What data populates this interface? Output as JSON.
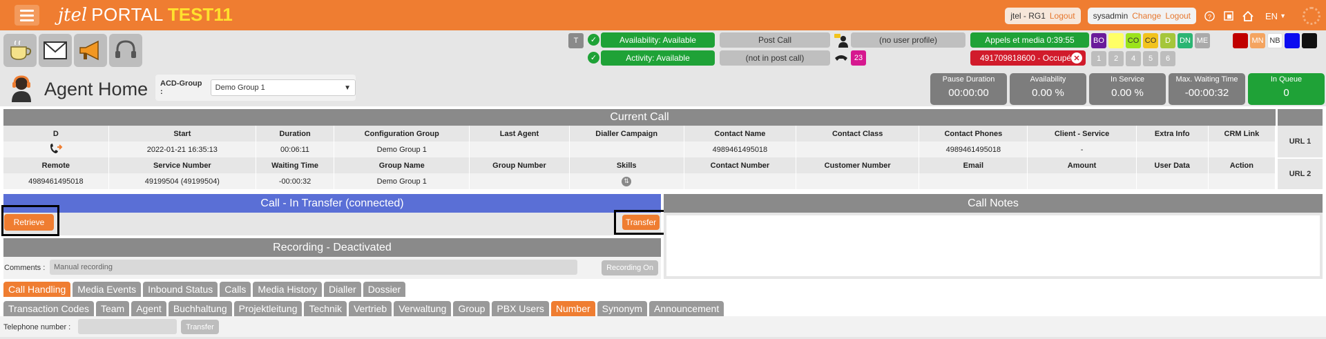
{
  "topbar": {
    "logo_j": "jtel",
    "logo_portal": "PORTAL",
    "logo_env": "TEST11",
    "client_label": "jtel - RG1",
    "client_logout": "Logout",
    "user_label": "sysadmin",
    "user_change": "Change",
    "user_logout": "Logout",
    "language": "EN",
    "icons": [
      "menu-icon",
      "help-icon",
      "window-icon",
      "home-icon",
      "chevron-down-icon",
      "spinner-icon"
    ]
  },
  "status": {
    "t_badge": "T",
    "availability": "Availability: Available",
    "activity": "Activity: Available",
    "post_call_title": "Post Call",
    "post_call_value": "(not in post call)",
    "user_profile": "(no user profile)",
    "queue_count": "23",
    "appels_media": "Appels et media 0:39:55",
    "busy_number": "491709818600 - Occupé",
    "codes_row1": [
      {
        "label": "BO",
        "bg": "#6a1b9a",
        "fg": "#ffffff"
      },
      {
        "label": "",
        "bg": "#ffff66",
        "fg": "#333333"
      },
      {
        "label": "CO",
        "bg": "#9be31b",
        "fg": "#333333"
      },
      {
        "label": "CO",
        "bg": "#f2c31d",
        "fg": "#333333"
      },
      {
        "label": "D",
        "bg": "#a5c63b",
        "fg": "#ffffff"
      },
      {
        "label": "DN",
        "bg": "#2bb573",
        "fg": "#ffffff"
      },
      {
        "label": "ME",
        "bg": "#aaaaaa",
        "fg": "#ffffff"
      }
    ],
    "codes_row1b": [
      {
        "label": "",
        "bg": "#c00000",
        "fg": "#ffffff"
      },
      {
        "label": "MN",
        "bg": "#f4a460",
        "fg": "#ffffff"
      },
      {
        "label": "NB",
        "bg": "#ffffff",
        "fg": "#333333"
      },
      {
        "label": "",
        "bg": "#0c0cf0",
        "fg": "#ffffff"
      },
      {
        "label": "",
        "bg": "#111111",
        "fg": "#ffffff"
      }
    ],
    "numbers_row2": [
      "1",
      "2",
      "4",
      "5",
      "6"
    ]
  },
  "agent": {
    "title": "Agent Home",
    "acd_label": "ACD-Group :",
    "acd_value": "Demo Group 1"
  },
  "kpis": [
    {
      "title": "Pause Duration",
      "value": "00:00:00",
      "bg": "#7d7d7d"
    },
    {
      "title": "Availability",
      "value": "0.00 %",
      "bg": "#7d7d7d"
    },
    {
      "title": "In Service",
      "value": "0.00 %",
      "bg": "#7d7d7d"
    },
    {
      "title": "Max. Waiting Time",
      "value": "-00:00:32",
      "bg": "#7d7d7d"
    },
    {
      "title": "In Queue",
      "value": "0",
      "bg": "#1fa237"
    }
  ],
  "current_call": {
    "title": "Current Call",
    "header1": [
      "D",
      "Start",
      "Duration",
      "Configuration Group",
      "Last Agent",
      "Dialler Campaign",
      "Contact Name",
      "Contact Class",
      "Contact Phones",
      "Client - Service",
      "Extra Info",
      "CRM Link"
    ],
    "values1": [
      "",
      "2022-01-21 16:35:13",
      "00:06:11",
      "Demo Group 1",
      "",
      "",
      "4989461495018",
      "",
      "4989461495018",
      "-",
      "",
      ""
    ],
    "header2": [
      "Remote",
      "Service Number",
      "Waiting Time",
      "Group Name",
      "Group Number",
      "Skills",
      "Contact Number",
      "Customer Number",
      "Email",
      "Amount",
      "User Data",
      "Action"
    ],
    "values2": [
      "4989461495018",
      "49199504 (49199504)",
      "-00:00:32",
      "Demo Group 1",
      "",
      "",
      "",
      "",
      "",
      "",
      "",
      ""
    ],
    "url1": "URL 1",
    "url2": "URL 2"
  },
  "transfer": {
    "title": "Call - In Transfer (connected)",
    "retrieve": "Retrieve",
    "transfer": "Transfer"
  },
  "notes": {
    "title": "Call Notes"
  },
  "recording": {
    "title": "Recording - Deactivated",
    "comments_label": "Comments :",
    "comments_value": "Manual recording",
    "button": "Recording On"
  },
  "tabs_row1": [
    {
      "label": "Call Handling",
      "active": true
    },
    {
      "label": "Media Events",
      "active": false
    },
    {
      "label": "Inbound Status",
      "active": false
    },
    {
      "label": "Calls",
      "active": false
    },
    {
      "label": "Media History",
      "active": false
    },
    {
      "label": "Dialler",
      "active": false
    },
    {
      "label": "Dossier",
      "active": false
    }
  ],
  "tabs_row2": [
    {
      "label": "Transaction Codes",
      "active": false
    },
    {
      "label": "Team",
      "active": false
    },
    {
      "label": "Agent",
      "active": false
    },
    {
      "label": "Buchhaltung",
      "active": false
    },
    {
      "label": "Projektleitung",
      "active": false
    },
    {
      "label": "Technik",
      "active": false
    },
    {
      "label": "Vertrieb",
      "active": false
    },
    {
      "label": "Verwaltung",
      "active": false
    },
    {
      "label": "Group",
      "active": false
    },
    {
      "label": "PBX Users",
      "active": false
    },
    {
      "label": "Number",
      "active": true
    },
    {
      "label": "Synonym",
      "active": false
    },
    {
      "label": "Announcement",
      "active": false
    }
  ],
  "telephone": {
    "label": "Telephone number :",
    "button": "Transfer"
  }
}
